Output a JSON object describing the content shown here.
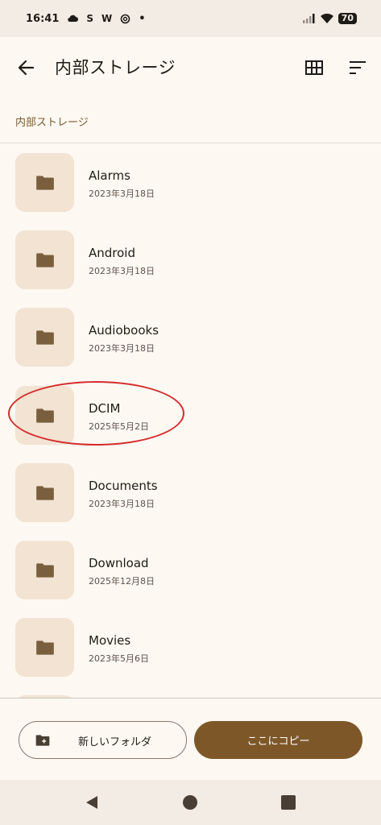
{
  "status_bar": {
    "time": "16:41",
    "left_icons": [
      "cloud-icon",
      "s-icon",
      "w-icon",
      "threads-icon",
      "dot-icon"
    ],
    "s_text": "S",
    "w_text": "W",
    "dot_text": "•",
    "battery": "70"
  },
  "app_bar": {
    "title": "内部ストレージ",
    "back_icon": "arrow-back-icon",
    "grid_icon": "grid-view-icon",
    "sort_icon": "sort-icon"
  },
  "breadcrumb": "内部ストレージ",
  "folders": [
    {
      "name": "Alarms",
      "date": "2023年3月18日"
    },
    {
      "name": "Android",
      "date": "2023年3月18日"
    },
    {
      "name": "Audiobooks",
      "date": "2023年3月18日"
    },
    {
      "name": "DCIM",
      "date": "2025年5月2日"
    },
    {
      "name": "Documents",
      "date": "2023年3月18日"
    },
    {
      "name": "Download",
      "date": "2025年12月8日"
    },
    {
      "name": "Movies",
      "date": "2023年5月6日"
    }
  ],
  "bottom": {
    "new_folder_label": "新しいフォルダ",
    "copy_label": "ここにコピー"
  },
  "colors": {
    "accent": "#7d5728",
    "thumb_bg": "#f2e3d3",
    "folder_icon": "#7a5f3e",
    "annotation": "#d42b2b"
  }
}
